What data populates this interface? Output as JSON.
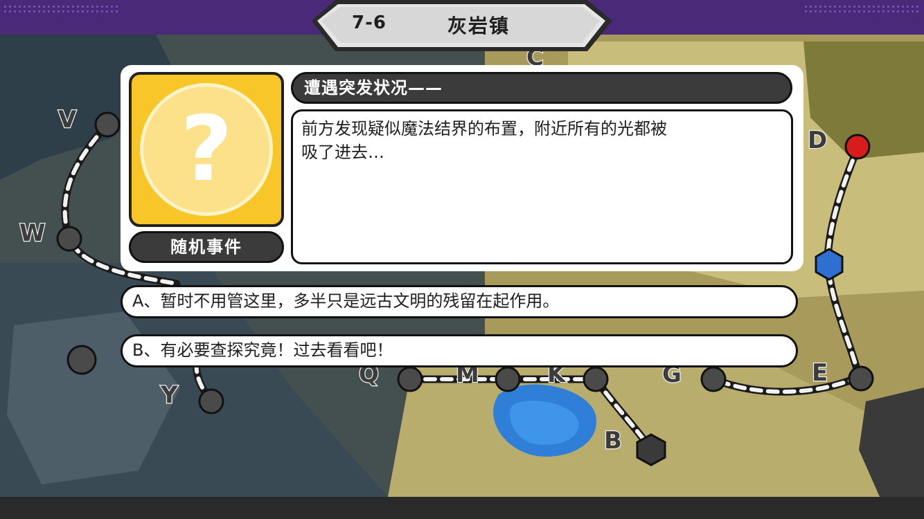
{
  "header": {
    "level_code": "7-6",
    "level_name": "灰岩镇"
  },
  "map": {
    "node_labels": [
      "V",
      "W",
      "Y",
      "Q",
      "M",
      "K",
      "G",
      "E",
      "D",
      "B",
      "C"
    ]
  },
  "event": {
    "type_label": "随机事件",
    "icon": "question-mark-icon",
    "title": "遭遇突发状况——",
    "description_line1": "前方发现疑似魔法结界的布置，附近所有的光都被",
    "description_line2": "吸了进去…"
  },
  "choices": [
    {
      "label": "A、暂时不用管这里，多半只是远古文明的残留在起作用。"
    },
    {
      "label": "B、有必要查探究竟！过去看看吧！"
    }
  ],
  "colors": {
    "frame_purple": "#4a2a78",
    "event_yellow": "#f9c629",
    "panel_dark": "#3b3b3b",
    "node_red": "#d81b1b",
    "node_blue": "#2f6fd0"
  }
}
